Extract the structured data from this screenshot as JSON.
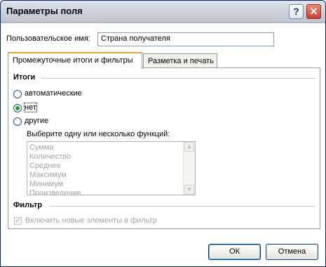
{
  "window": {
    "title": "Параметры поля"
  },
  "field": {
    "label": "Пользовательское имя:",
    "value": "Страна получателя"
  },
  "tabs": [
    {
      "label": "Промежуточные итоги и фильтры",
      "active": true
    },
    {
      "label": "Разметка и печать",
      "active": false
    }
  ],
  "subtotals": {
    "section_title": "Итоги",
    "options": [
      {
        "label": "автоматические",
        "selected": false
      },
      {
        "label": "нет",
        "selected": true
      },
      {
        "label": "другие",
        "selected": false
      }
    ],
    "functions_label": "Выберите одну или несколько функций:",
    "functions": [
      "Сумма",
      "Количество",
      "Среднее",
      "Максимум",
      "Минимум",
      "Произведение"
    ]
  },
  "filter": {
    "section_title": "Фильтр",
    "checkbox_label": "Включить новые элементы в фильтр",
    "checked": true
  },
  "buttons": {
    "ok": "ОК",
    "cancel": "Отмена"
  }
}
